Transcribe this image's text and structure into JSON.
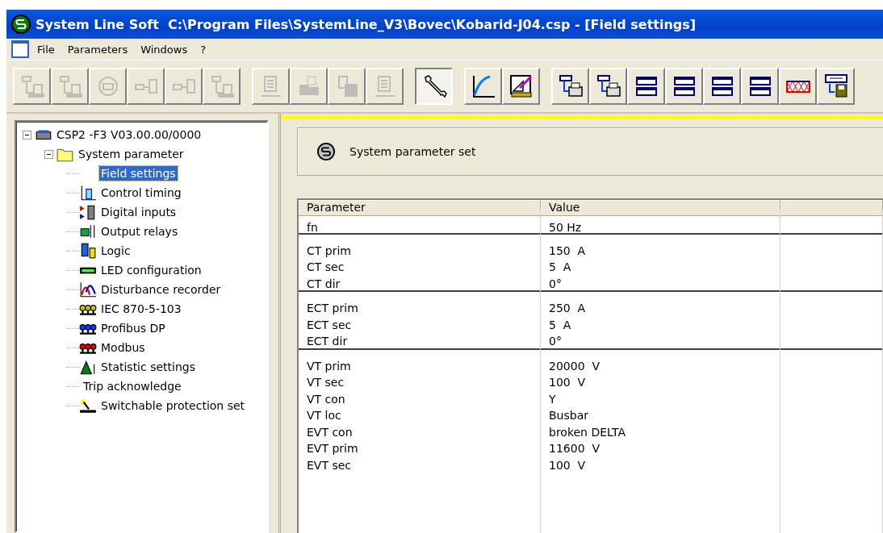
{
  "window": {
    "title": "System Line Soft  C:\\Program Files\\SystemLine_V3\\Bovec\\Kobarid-J04.csp - [Field settings]"
  },
  "menu": [
    "File",
    "Parameters",
    "Windows",
    "?"
  ],
  "toolbar": [
    {
      "disabled": true,
      "pressed": false
    },
    {
      "disabled": true,
      "pressed": false
    },
    {
      "disabled": true,
      "pressed": false
    },
    {
      "disabled": true,
      "pressed": false
    },
    {
      "disabled": true,
      "pressed": false
    },
    {
      "disabled": true,
      "pressed": false
    },
    {
      "disabled": true,
      "pressed": false
    },
    {
      "disabled": true,
      "pressed": false
    },
    {
      "disabled": true,
      "pressed": false
    },
    {
      "disabled": true,
      "pressed": false
    },
    {
      "disabled": false,
      "pressed": true
    },
    {
      "disabled": false,
      "pressed": false
    },
    {
      "disabled": false,
      "pressed": false
    },
    {
      "disabled": false,
      "pressed": false
    },
    {
      "disabled": false,
      "pressed": false
    },
    {
      "disabled": false,
      "pressed": false
    },
    {
      "disabled": false,
      "pressed": false
    },
    {
      "disabled": false,
      "pressed": false
    },
    {
      "disabled": false,
      "pressed": false
    },
    {
      "disabled": false,
      "pressed": false
    },
    {
      "disabled": false,
      "pressed": false
    }
  ],
  "tree": [
    {
      "label": "CSP2 -F3  V03.00.00/0000",
      "expanded": true,
      "selected": false,
      "children": [
        {
          "label": "System parameter",
          "expanded": true,
          "selected": false,
          "children": [
            {
              "label": "Field settings",
              "selected": true
            },
            {
              "label": "Control timing",
              "selected": false
            },
            {
              "label": "Digital inputs",
              "selected": false
            },
            {
              "label": "Output relays",
              "selected": false
            },
            {
              "label": "Logic",
              "selected": false
            },
            {
              "label": "LED configuration",
              "selected": false
            },
            {
              "label": "Disturbance recorder",
              "selected": false
            },
            {
              "label": "IEC 870-5-103",
              "selected": false
            },
            {
              "label": "Profibus DP",
              "selected": false
            },
            {
              "label": "Modbus",
              "selected": false
            },
            {
              "label": "Statistic settings",
              "selected": false
            },
            {
              "label": "Trip  acknowledge",
              "selected": false
            },
            {
              "label": "Switchable protection set",
              "selected": false
            }
          ]
        }
      ]
    }
  ],
  "panel": {
    "title": "System parameter set"
  },
  "table": {
    "columns": [
      "Parameter",
      "Value"
    ],
    "groups": [
      {
        "rows": [
          {
            "parameter": "fn",
            "value": "50 Hz"
          }
        ]
      },
      {
        "rows": [
          {
            "parameter": "CT prim",
            "value": "150  A"
          },
          {
            "parameter": "CT sec",
            "value": "5  A"
          },
          {
            "parameter": "CT dir",
            "value": "0°"
          }
        ]
      },
      {
        "rows": [
          {
            "parameter": "ECT prim",
            "value": "250  A"
          },
          {
            "parameter": "ECT sec",
            "value": "5  A"
          },
          {
            "parameter": "ECT dir",
            "value": "0°"
          }
        ]
      },
      {
        "rows": [
          {
            "parameter": "VT prim",
            "value": "20000  V"
          },
          {
            "parameter": "VT sec",
            "value": "100  V"
          },
          {
            "parameter": "VT con",
            "value": "Y"
          },
          {
            "parameter": "VT loc",
            "value": "Busbar"
          },
          {
            "parameter": "EVT con",
            "value": "broken DELTA"
          },
          {
            "parameter": "EVT prim",
            "value": "11600  V"
          },
          {
            "parameter": "EVT sec",
            "value": "100  V"
          }
        ]
      }
    ]
  }
}
